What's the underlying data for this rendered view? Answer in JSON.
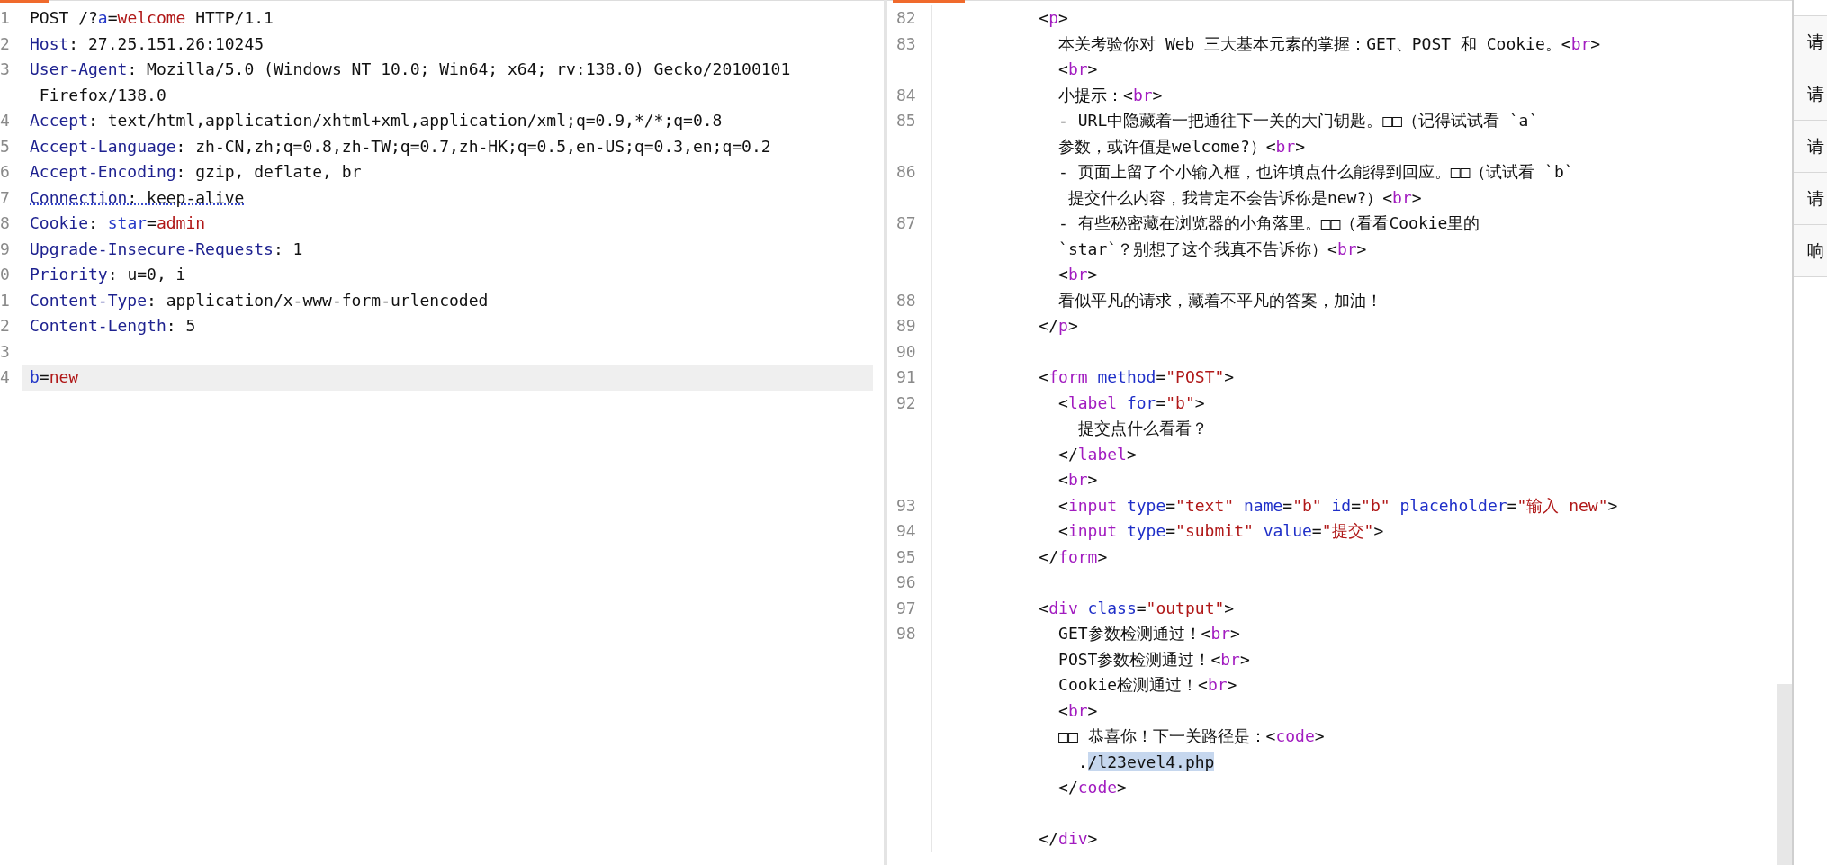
{
  "request": {
    "lines": [
      {
        "number": "1",
        "current": false,
        "dotted_underline": false,
        "rows": [
          {
            "segments": [
              "POST /?",
              {
                "kind": "param",
                "text": "a"
              },
              "=",
              {
                "kind": "value",
                "text": "welcome"
              },
              " HTTP/1.1"
            ]
          }
        ]
      },
      {
        "number": "2",
        "current": false,
        "dotted_underline": false,
        "rows": [
          {
            "segments": [
              {
                "kind": "header",
                "text": "Host"
              },
              ": 27.25.151.26:10245"
            ]
          }
        ]
      },
      {
        "number": "3",
        "current": false,
        "dotted_underline": false,
        "rows": [
          {
            "segments": [
              {
                "kind": "header",
                "text": "User-Agent"
              },
              ": Mozilla/5.0 (Windows NT 10.0; Win64; x64; rv:138.0) Gecko/20100101"
            ]
          },
          {
            "segments": [
              " Firefox/138.0"
            ]
          }
        ]
      },
      {
        "number": "4",
        "current": false,
        "dotted_underline": false,
        "rows": [
          {
            "segments": [
              {
                "kind": "header",
                "text": "Accept"
              },
              ": text/html,application/xhtml+xml,application/xml;q=0.9,*/*;q=0.8"
            ]
          }
        ]
      },
      {
        "number": "5",
        "current": false,
        "dotted_underline": false,
        "rows": [
          {
            "segments": [
              {
                "kind": "header",
                "text": "Accept-Language"
              },
              ": zh-CN,zh;q=0.8,zh-TW;q=0.7,zh-HK;q=0.5,en-US;q=0.3,en;q=0.2"
            ]
          }
        ]
      },
      {
        "number": "6",
        "current": false,
        "dotted_underline": false,
        "rows": [
          {
            "segments": [
              {
                "kind": "header",
                "text": "Accept-Encoding"
              },
              ": gzip, deflate, br"
            ]
          }
        ]
      },
      {
        "number": "7",
        "current": false,
        "dotted_underline": true,
        "rows": [
          {
            "segments": [
              {
                "kind": "header",
                "text": "Connection"
              },
              ": keep-alive"
            ]
          }
        ]
      },
      {
        "number": "8",
        "current": false,
        "dotted_underline": false,
        "rows": [
          {
            "segments": [
              {
                "kind": "header",
                "text": "Cookie"
              },
              ": ",
              {
                "kind": "param",
                "text": "star"
              },
              "=",
              {
                "kind": "value",
                "text": "admin"
              }
            ]
          }
        ]
      },
      {
        "number": "9",
        "current": false,
        "dotted_underline": false,
        "rows": [
          {
            "segments": [
              {
                "kind": "header",
                "text": "Upgrade-Insecure-Requests"
              },
              ": 1"
            ]
          }
        ]
      },
      {
        "number": "0",
        "current": false,
        "dotted_underline": false,
        "rows": [
          {
            "segments": [
              {
                "kind": "header",
                "text": "Priority"
              },
              ": u=0, i"
            ]
          }
        ]
      },
      {
        "number": "1",
        "current": false,
        "dotted_underline": false,
        "rows": [
          {
            "segments": [
              {
                "kind": "header",
                "text": "Content-Type"
              },
              ": application/x-www-form-urlencoded"
            ]
          }
        ]
      },
      {
        "number": "2",
        "current": false,
        "dotted_underline": false,
        "rows": [
          {
            "segments": [
              {
                "kind": "header",
                "text": "Content-Length"
              },
              ": 5"
            ]
          }
        ]
      },
      {
        "number": "3",
        "current": false
      },
      {
        "number": "4",
        "current": true,
        "dotted_underline": false,
        "rows": [
          {
            "segments": [
              {
                "kind": "param",
                "text": "b"
              },
              "=",
              {
                "kind": "value",
                "text": "new"
              }
            ]
          }
        ]
      }
    ]
  },
  "response": {
    "lines": [
      {
        "number": "82",
        "rows": [
          {
            "segments": [
              "          <",
              {
                "kind": "tag",
                "text": "p"
              },
              ">"
            ]
          }
        ]
      },
      {
        "number": "83",
        "rows": [
          {
            "segments": [
              "            本关考验你对 Web 三大基本元素的掌握：GET、POST 和 Cookie。<",
              {
                "kind": "tag",
                "text": "br"
              },
              ">"
            ]
          },
          {
            "segments": [
              "            <",
              {
                "kind": "tag",
                "text": "br"
              },
              ">"
            ]
          }
        ]
      },
      {
        "number": "84",
        "rows": [
          {
            "segments": [
              "            小提示：<",
              {
                "kind": "tag",
                "text": "br"
              },
              ">"
            ]
          }
        ]
      },
      {
        "number": "85",
        "rows": [
          {
            "segments": [
              "            - URL中隐藏着一把通往下一关的大门钥匙。□□（记得试试看 `a`"
            ]
          },
          {
            "segments": [
              "            参数，或许值是welcome?）<",
              {
                "kind": "tag",
                "text": "br"
              },
              ">"
            ]
          }
        ]
      },
      {
        "number": "86",
        "rows": [
          {
            "segments": [
              "            - 页面上留了个小输入框，也许填点什么能得到回应。□□（试试看 `b`"
            ]
          },
          {
            "segments": [
              "             提交什么内容，我肯定不会告诉你是new?）<",
              {
                "kind": "tag",
                "text": "br"
              },
              ">"
            ]
          }
        ]
      },
      {
        "number": "87",
        "rows": [
          {
            "segments": [
              "            - 有些秘密藏在浏览器的小角落里。□□（看看Cookie里的"
            ]
          },
          {
            "segments": [
              "            `star`？别想了这个我真不告诉你）<",
              {
                "kind": "tag",
                "text": "br"
              },
              ">"
            ]
          },
          {
            "segments": [
              "            <",
              {
                "kind": "tag",
                "text": "br"
              },
              ">"
            ]
          }
        ]
      },
      {
        "number": "88",
        "rows": [
          {
            "segments": [
              "            看似平凡的请求，藏着不平凡的答案，加油！"
            ]
          }
        ]
      },
      {
        "number": "89",
        "rows": [
          {
            "segments": [
              "          </",
              {
                "kind": "tag",
                "text": "p"
              },
              ">"
            ]
          }
        ]
      },
      {
        "number": "90"
      },
      {
        "number": "91",
        "rows": [
          {
            "segments": [
              "          <",
              {
                "kind": "tag",
                "text": "form"
              },
              {
                "kind": "attr",
                "text": " method"
              },
              "=",
              {
                "kind": "string",
                "text": "\"POST\""
              },
              ">"
            ]
          }
        ]
      },
      {
        "number": "92",
        "rows": [
          {
            "segments": [
              "            <",
              {
                "kind": "tag",
                "text": "label"
              },
              {
                "kind": "attr",
                "text": " for"
              },
              "=",
              {
                "kind": "string",
                "text": "\"b\""
              },
              ">"
            ]
          },
          {
            "segments": [
              "              提交点什么看看？"
            ]
          },
          {
            "segments": [
              "            </",
              {
                "kind": "tag",
                "text": "label"
              },
              ">"
            ]
          },
          {
            "segments": [
              "            <",
              {
                "kind": "tag",
                "text": "br"
              },
              ">"
            ]
          }
        ]
      },
      {
        "number": "93",
        "rows": [
          {
            "segments": [
              "            <",
              {
                "kind": "tag",
                "text": "input"
              },
              {
                "kind": "attr",
                "text": " type"
              },
              "=",
              {
                "kind": "string",
                "text": "\"text\""
              },
              {
                "kind": "attr",
                "text": " name"
              },
              "=",
              {
                "kind": "string",
                "text": "\"b\""
              },
              {
                "kind": "attr",
                "text": " id"
              },
              "=",
              {
                "kind": "string",
                "text": "\"b\""
              },
              {
                "kind": "attr",
                "text": " placeholder"
              },
              "=",
              {
                "kind": "string",
                "text": "\"输入 new\""
              },
              ">"
            ]
          }
        ]
      },
      {
        "number": "94",
        "rows": [
          {
            "segments": [
              "            <",
              {
                "kind": "tag",
                "text": "input"
              },
              {
                "kind": "attr",
                "text": " type"
              },
              "=",
              {
                "kind": "string",
                "text": "\"submit\""
              },
              {
                "kind": "attr",
                "text": " value"
              },
              "=",
              {
                "kind": "string",
                "text": "\"提交\""
              },
              ">"
            ]
          }
        ]
      },
      {
        "number": "95",
        "rows": [
          {
            "segments": [
              "          </",
              {
                "kind": "tag",
                "text": "form"
              },
              ">"
            ]
          }
        ]
      },
      {
        "number": "96"
      },
      {
        "number": "97",
        "rows": [
          {
            "segments": [
              "          <",
              {
                "kind": "tag",
                "text": "div"
              },
              {
                "kind": "attr",
                "text": " class"
              },
              "=",
              {
                "kind": "string",
                "text": "\"output\""
              },
              ">"
            ]
          }
        ]
      },
      {
        "number": "98",
        "rows": [
          {
            "segments": [
              "            GET参数检测通过！<",
              {
                "kind": "tag",
                "text": "br"
              },
              ">"
            ]
          },
          {
            "segments": [
              "            POST参数检测通过！<",
              {
                "kind": "tag",
                "text": "br"
              },
              ">"
            ]
          },
          {
            "segments": [
              "            Cookie检测通过！<",
              {
                "kind": "tag",
                "text": "br"
              },
              ">"
            ]
          },
          {
            "segments": [
              "            <",
              {
                "kind": "tag",
                "text": "br"
              },
              ">"
            ]
          },
          {
            "segments": [
              "            □□ 恭喜你！下一关路径是：<",
              {
                "kind": "tag",
                "text": "code"
              },
              ">"
            ]
          },
          {
            "segments": [
              "              .",
              {
                "kind": "selection",
                "text": "/l23evel4.php"
              }
            ]
          },
          {
            "segments": [
              "            </",
              {
                "kind": "tag",
                "text": "code"
              },
              ">"
            ]
          },
          null,
          {
            "segments": [
              "          </",
              {
                "kind": "tag",
                "text": "div"
              },
              ">"
            ]
          }
        ]
      }
    ]
  },
  "side_tabs": [
    {
      "label": "请"
    },
    {
      "label": "请"
    },
    {
      "label": "请"
    },
    {
      "label": "请"
    },
    {
      "label": "响"
    }
  ]
}
